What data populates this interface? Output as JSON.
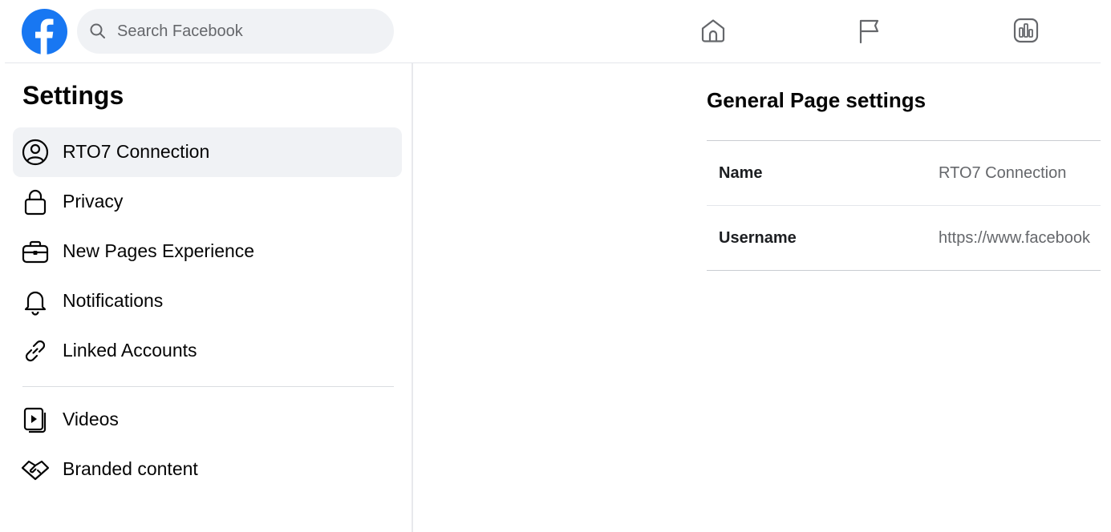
{
  "header": {
    "search_placeholder": "Search Facebook",
    "logo_icon": "facebook-logo-icon",
    "nav_icons": [
      "home-icon",
      "flag-icon",
      "insights-icon"
    ],
    "brand_color": "#1877f2"
  },
  "sidebar": {
    "title": "Settings",
    "items": [
      {
        "label": "RTO7 Connection",
        "icon": "profile-circle-icon",
        "active": true
      },
      {
        "label": "Privacy",
        "icon": "lock-icon",
        "active": false
      },
      {
        "label": "New Pages Experience",
        "icon": "briefcase-icon",
        "active": false
      },
      {
        "label": "Notifications",
        "icon": "bell-icon",
        "active": false
      },
      {
        "label": "Linked Accounts",
        "icon": "link-icon",
        "active": false
      }
    ],
    "items_secondary": [
      {
        "label": "Videos",
        "icon": "video-icon",
        "active": false
      },
      {
        "label": "Branded content",
        "icon": "handshake-icon",
        "active": false
      }
    ]
  },
  "main": {
    "title": "General Page settings",
    "rows": [
      {
        "label": "Name",
        "value": "RTO7 Connection"
      },
      {
        "label": "Username",
        "value": "https://www.facebook"
      }
    ]
  }
}
